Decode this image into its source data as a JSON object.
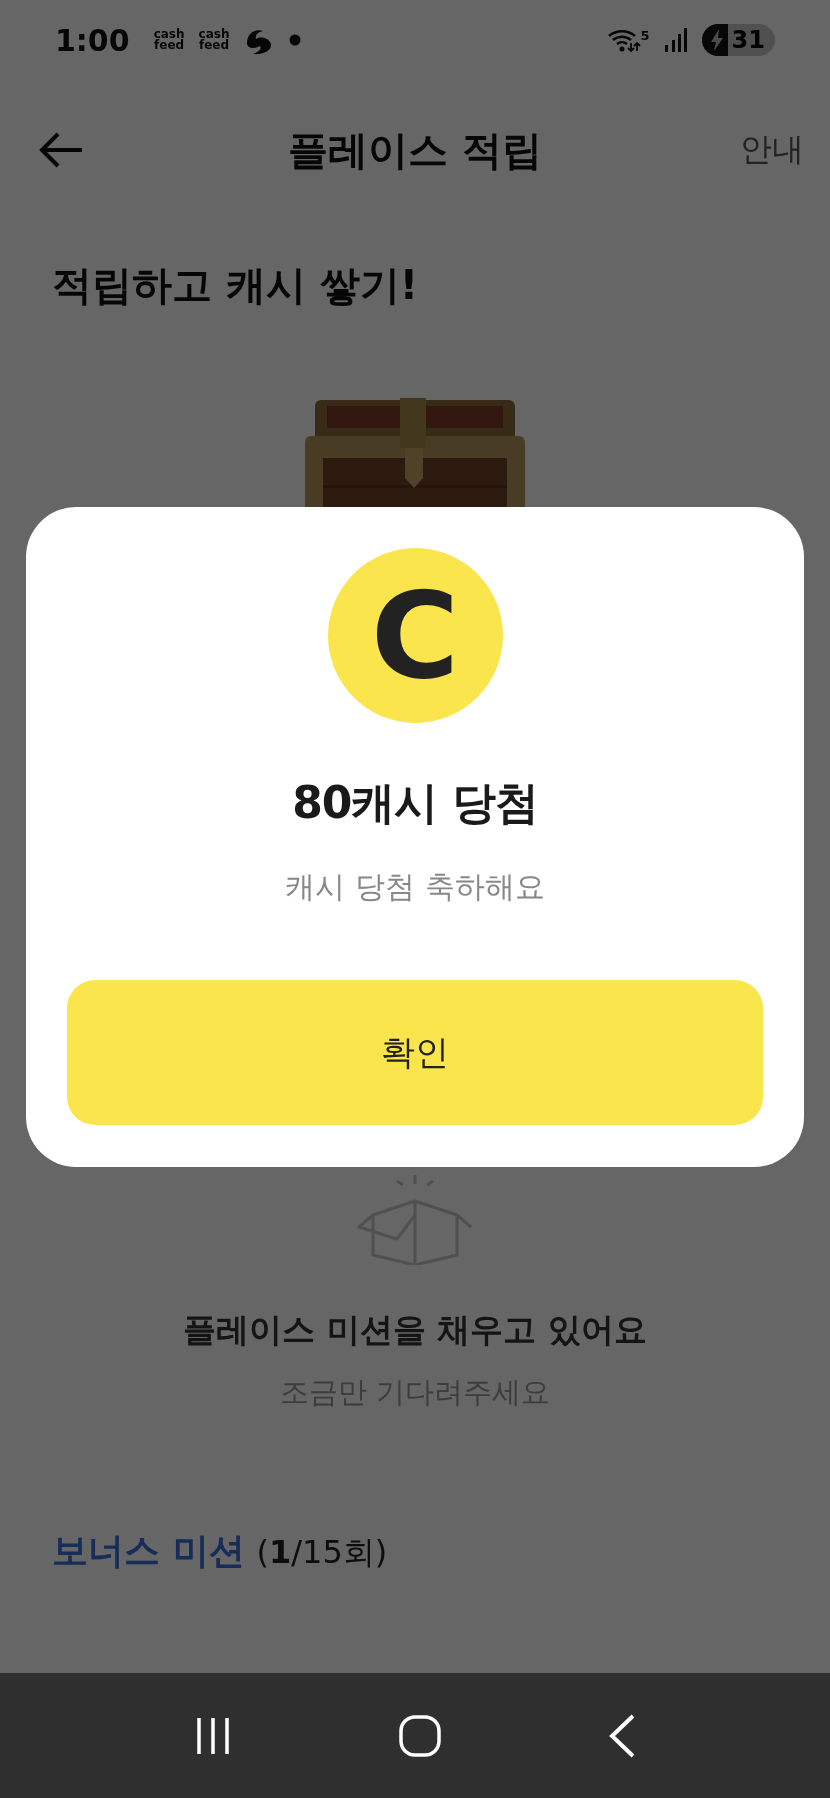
{
  "status_bar": {
    "time": "1:00",
    "notifications": [
      {
        "kind": "cashfeed",
        "top": "cash",
        "bottom": "feed"
      },
      {
        "kind": "cashfeed",
        "top": "cash",
        "bottom": "feed"
      },
      {
        "kind": "swirl"
      },
      {
        "kind": "dot"
      }
    ],
    "wifi_badge": "5",
    "battery": "31",
    "charging": true
  },
  "header": {
    "title": "플레이스 적립",
    "action": "안내"
  },
  "heading": "적립하고 캐시 쌓기!",
  "mission_status": {
    "title": "플레이스 미션을 채우고 있어요",
    "subtitle": "조금만 기다려주세요"
  },
  "bonus": {
    "title": "보너스 미션",
    "count": "(**1**/15회)"
  },
  "dialog": {
    "coin": "C",
    "title": "80캐시 당첨",
    "subtitle": "캐시 당첨 축하해요",
    "button": "확인"
  }
}
